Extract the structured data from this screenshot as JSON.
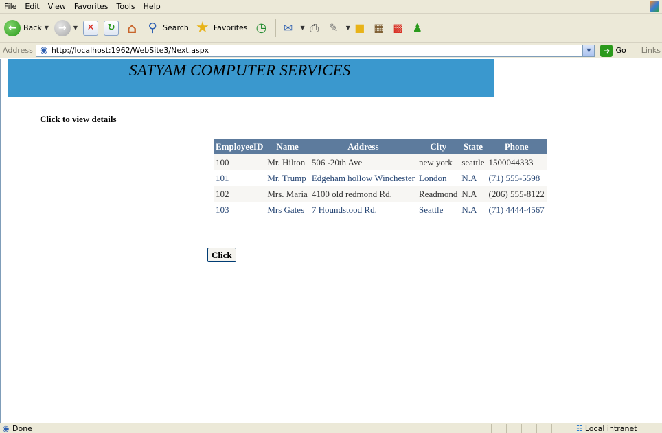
{
  "menu": [
    "File",
    "Edit",
    "View",
    "Favorites",
    "Tools",
    "Help"
  ],
  "toolbar": {
    "back_label": "Back",
    "search_label": "Search",
    "favorites_label": "Favorites"
  },
  "address": {
    "label": "Address",
    "url": "http://localhost:1962/WebSite3/Next.aspx",
    "go_label": "Go",
    "links_label": "Links"
  },
  "page": {
    "banner_title": "SATYAM COMPUTER SERVICES",
    "banner_color": "#3a98ce",
    "heading": "Click to view details",
    "button_label": "Click"
  },
  "table": {
    "header_color": "#5d7b9d",
    "columns": [
      "EmployeeID",
      "Name",
      "Address",
      "City",
      "State",
      "Phone"
    ],
    "rows": [
      [
        "100",
        "Mr. Hilton",
        "506 -20th Ave",
        "new york",
        "seattle",
        "1500044333"
      ],
      [
        "101",
        "Mr. Trump",
        "Edgeham hollow Winchester",
        "London",
        "N.A",
        "(71) 555-5598"
      ],
      [
        "102",
        "Mrs. Maria",
        "4100 old redmond Rd.",
        "Readmond",
        "N.A",
        "(206) 555-8122"
      ],
      [
        "103",
        "Mrs Gates",
        "7 Houndstood Rd.",
        "Seattle",
        "N.A",
        "(71) 4444-4567"
      ]
    ]
  },
  "status": {
    "text": "Done",
    "zone": "Local intranet"
  }
}
